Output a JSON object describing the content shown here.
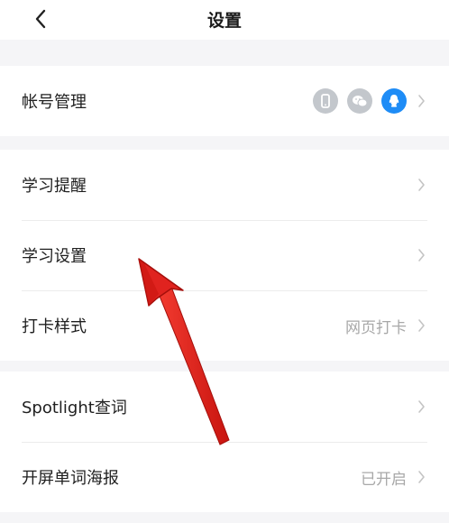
{
  "header": {
    "title": "设置",
    "back_icon": "chevron-left-icon"
  },
  "account_group": {
    "label": "帐号管理",
    "icons": [
      "phone-icon",
      "wechat-icon",
      "qq-icon"
    ],
    "icon_colors": {
      "phone": "#c3c7cc",
      "wechat": "#c3c7cc",
      "qq": "#1e8cf6"
    }
  },
  "study_group": {
    "items": [
      {
        "label": "学习提醒",
        "value": ""
      },
      {
        "label": "学习设置",
        "value": ""
      },
      {
        "label": "打卡样式",
        "value": "网页打卡"
      }
    ]
  },
  "feature_group": {
    "items": [
      {
        "label": "Spotlight查词",
        "value": ""
      },
      {
        "label": "开屏单词海报",
        "value": "已开启"
      }
    ]
  },
  "annotation": {
    "type": "red-arrow",
    "color": "#e0231f"
  }
}
